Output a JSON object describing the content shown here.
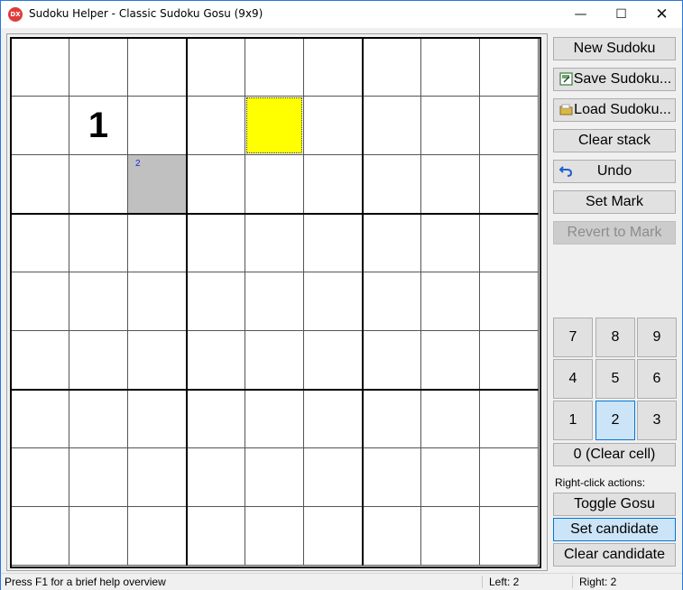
{
  "window": {
    "title": "Sudoku Helper - Classic Sudoku Gosu (9x9)",
    "icon_text": "DX",
    "minimize_glyph": "—",
    "maximize_glyph": "☐",
    "close_glyph": "✕"
  },
  "board": {
    "rows": [
      [
        "",
        "",
        "",
        "",
        "",
        "",
        "",
        "",
        ""
      ],
      [
        "",
        "1",
        "",
        "",
        "",
        "",
        "",
        "",
        ""
      ],
      [
        "",
        "",
        "",
        "",
        "",
        "",
        "",
        "",
        ""
      ],
      [
        "",
        "",
        "",
        "",
        "",
        "",
        "",
        "",
        ""
      ],
      [
        "",
        "",
        "",
        "",
        "",
        "",
        "",
        "",
        ""
      ],
      [
        "",
        "",
        "",
        "",
        "",
        "",
        "",
        "",
        ""
      ],
      [
        "",
        "",
        "",
        "",
        "",
        "",
        "",
        "",
        ""
      ],
      [
        "",
        "",
        "",
        "",
        "",
        "",
        "",
        "",
        ""
      ],
      [
        "",
        "",
        "",
        "",
        "",
        "",
        "",
        "",
        ""
      ]
    ],
    "candidates": [
      {
        "row": 2,
        "col": 2,
        "text": "2"
      }
    ],
    "highlighted_cell": {
      "row": 1,
      "col": 4,
      "color": "#ffff00"
    },
    "selected_cell": {
      "row": 2,
      "col": 2,
      "color": "#c0c0c0"
    }
  },
  "actions": {
    "new_sudoku": "New Sudoku",
    "save_sudoku": "Save Sudoku...",
    "load_sudoku": "Load Sudoku...",
    "clear_stack": "Clear stack",
    "undo": "Undo",
    "set_mark": "Set Mark",
    "revert_to_mark": "Revert to Mark"
  },
  "numpad": {
    "keys": [
      "7",
      "8",
      "9",
      "4",
      "5",
      "6",
      "1",
      "2",
      "3"
    ],
    "selected": "2",
    "clear_cell": "0 (Clear cell)"
  },
  "right_click": {
    "label": "Right-click actions:",
    "toggle_gosu": "Toggle Gosu",
    "set_candidate": "Set candidate",
    "clear_candidate": "Clear candidate",
    "selected": "Set candidate"
  },
  "status": {
    "help": "Press F1 for a brief help overview",
    "left": "Left: 2",
    "right": "Right: 2"
  },
  "colors": {
    "accent": "#0078d7",
    "candidate_text": "#1a2bd6",
    "highlight": "#ffff00",
    "selection": "#c0c0c0"
  }
}
